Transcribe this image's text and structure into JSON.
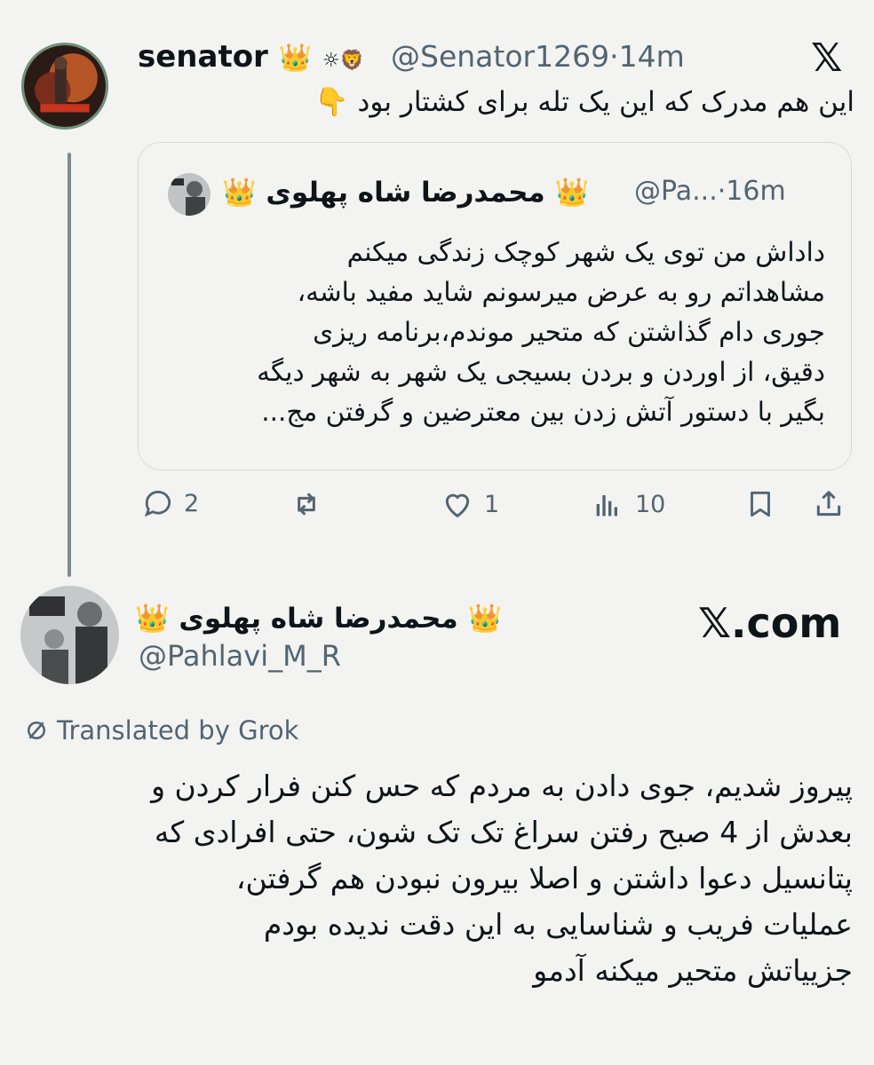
{
  "tweet": {
    "author_name": "senator",
    "author_handle": "@Senator1269",
    "time": "14m",
    "sun_lion_emoji": "☼🦁",
    "crown_emoji": "👑",
    "text": "این هم مدرک که این یک تله برای کشتار بود 👇",
    "x_logo": "𝕏",
    "quoted": {
      "author_name": "محمدرضا شاه پهلوی",
      "author_handle": "@Pa...",
      "time": "16m",
      "lines": [
        "داداش من توی یک شهر کوچک زندگی میکنم",
        "مشاهداتم رو به عرض میرسونم شاید مفید باشه،",
        "جوری دام گذاشتن که متحیر موندم،برنامه ریزی",
        "دقیق، از اوردن و بردن بسیجی یک شهر به شهر دیگه",
        "بگیر با دستور آتش زدن بین معترضین و گرفتن مج..."
      ]
    },
    "actions": {
      "replies": "2",
      "reposts": "",
      "likes": "1",
      "views": "10"
    }
  },
  "card": {
    "author_name": "محمدرضا شاه پهلوی",
    "author_handle": "@Pahlavi_M_R",
    "domain": "𝕏.com",
    "translated_label": "Translated by Grok",
    "lines": [
      "پیروز شدیم، جوی دادن به مردم که حس کنن فرار کردن و",
      "بعدش از 4 صبح رفتن سراغ تک تک شون، حتی افرادی که",
      "پتانسیل دعوا داشتن و اصلا بیرون نبودن هم گرفتن،",
      "عملیات فریب و شناسایی به این دقت ندیده بودم",
      "جزییاتش متحیر میکنه آدمو"
    ]
  },
  "colors": {
    "background": "#f3f4f2",
    "secondary_text": "#536471",
    "thread_line": "#7f8a8f"
  }
}
